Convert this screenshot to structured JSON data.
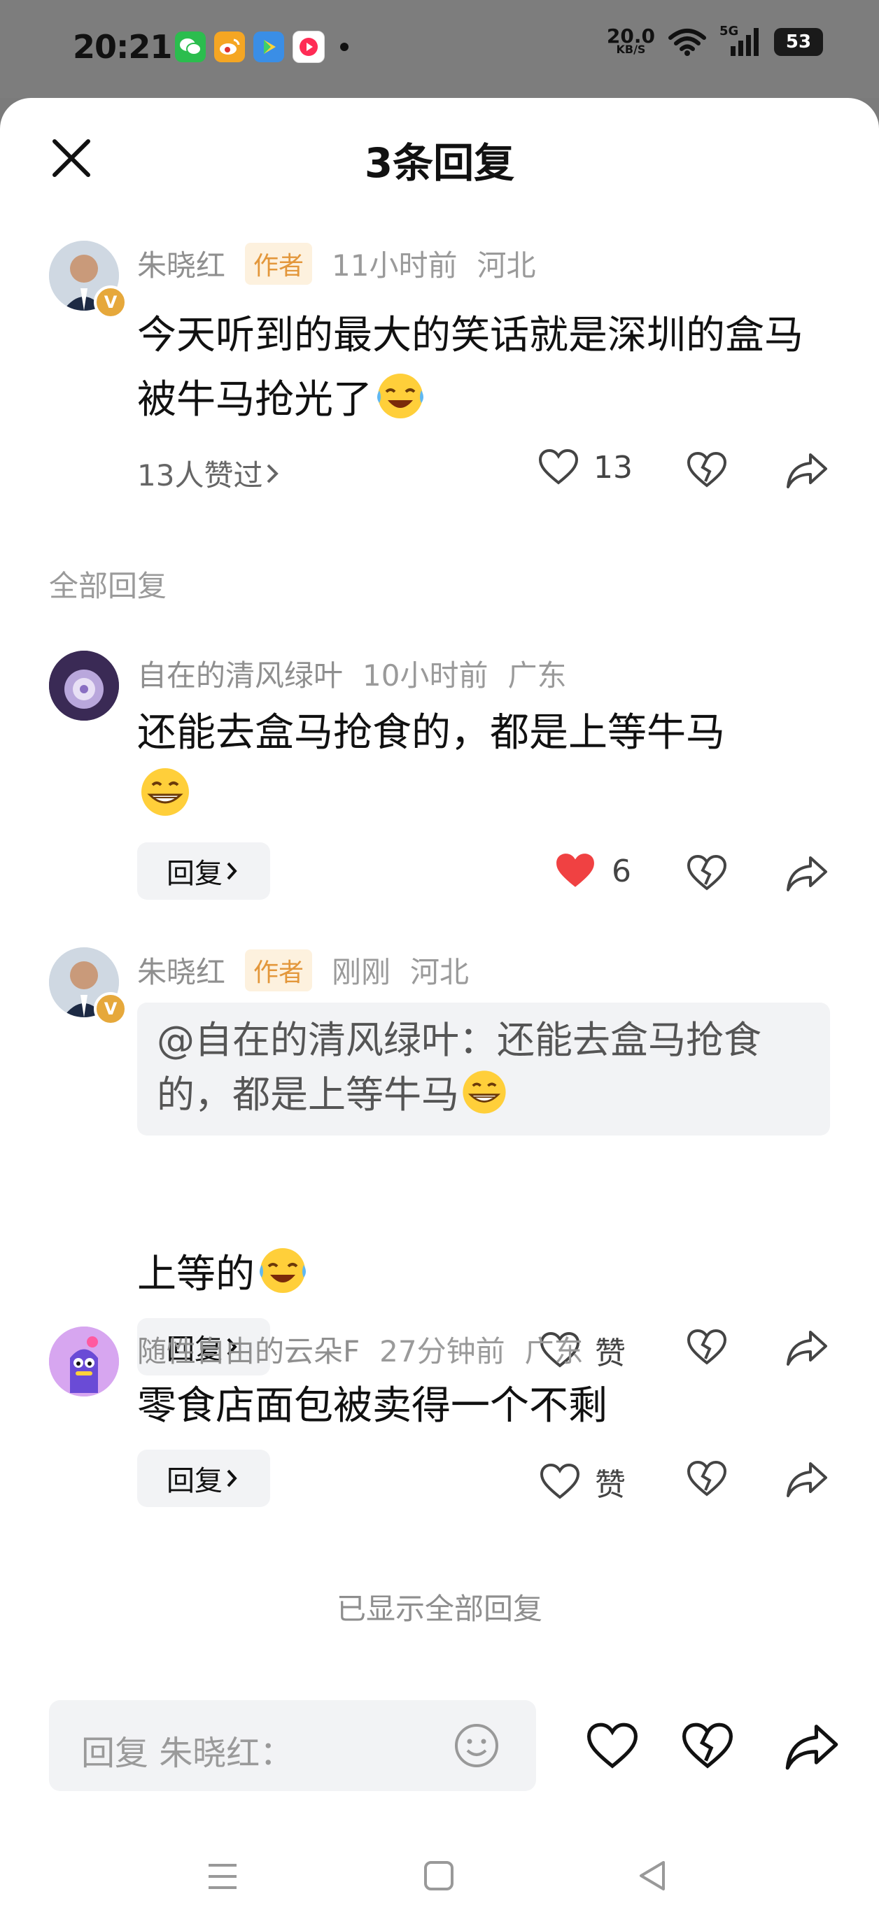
{
  "status_bar": {
    "time": "20:21",
    "net_speed_value": "20.0",
    "net_speed_unit": "KB/S",
    "network": "5G",
    "battery": "53",
    "apps": [
      "wechat-icon",
      "weibo-icon",
      "video-app-icon",
      "video-app-2-icon"
    ]
  },
  "header": {
    "title": "3条回复"
  },
  "main_comment": {
    "author": "朱晓红",
    "badge": "作者",
    "time": "11小时前",
    "location": "河北",
    "text": "今天听到的最大的笑话就是深圳的盒马被牛马抢光了",
    "likers": "13人赞过",
    "like_count": "13"
  },
  "section_label": "全部回复",
  "replies": [
    {
      "author": "自在的清风绿叶",
      "time": "10小时前",
      "location": "广东",
      "text": "还能去盒马抢食的，都是上等牛马",
      "reply_label": "回复",
      "like_count": "6"
    },
    {
      "author": "朱晓红",
      "badge": "作者",
      "time": "刚刚",
      "location": "河北",
      "quote": "@自在的清风绿叶：还能去盒马抢食的，都是上等牛马",
      "text": "上等的",
      "reply_label": "回复",
      "like_label": "赞"
    },
    {
      "author": "随性自由的云朵F",
      "time": "27分钟前",
      "location": "广东",
      "text": "零食店面包被卖得一个不剩",
      "reply_label": "回复",
      "like_label": "赞"
    }
  ],
  "footer_note": "已显示全部回复",
  "input": {
    "placeholder": "回复 朱晓红："
  },
  "colors": {
    "accent_red": "#f04142",
    "author_badge": "#e3973b",
    "vip": "#e6a83b"
  }
}
